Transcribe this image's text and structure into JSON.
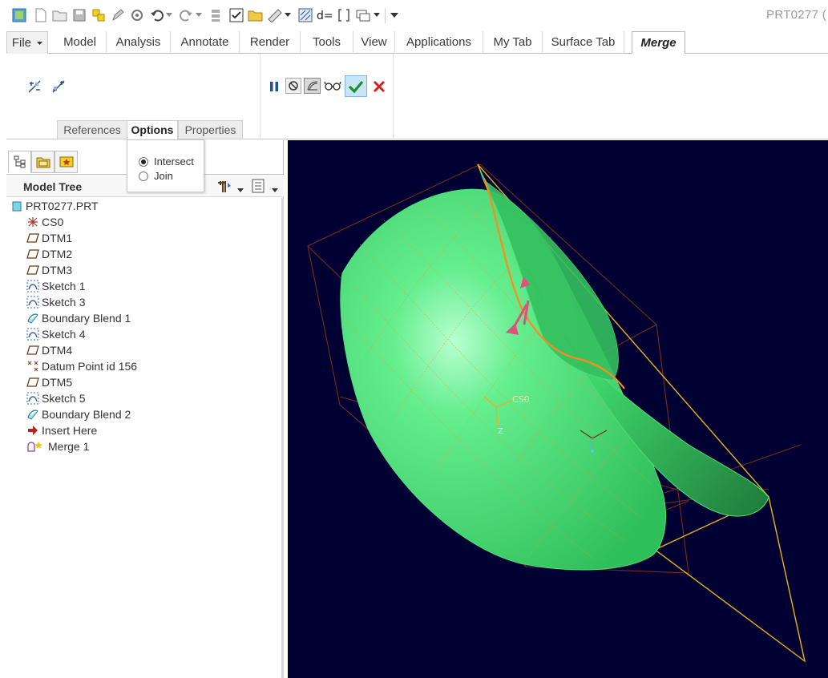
{
  "window": {
    "title": "PRT0277 ("
  },
  "quick_access": {
    "icons": [
      "model-icon",
      "new-icon",
      "open-icon",
      "save-icon",
      "regenerate-icon",
      "edit-icon",
      "settings-icon",
      "undo-icon",
      "redo-icon",
      "repeat-icon",
      "checkmark-box-icon",
      "folder-icon",
      "ruler-icon",
      "datum-display-icon",
      "dimension-icon",
      "brackets-icon",
      "window-icon",
      "customize-icon"
    ]
  },
  "ribbon": {
    "tabs": [
      {
        "label": "File"
      },
      {
        "label": "Model"
      },
      {
        "label": "Analysis"
      },
      {
        "label": "Annotate"
      },
      {
        "label": "Render"
      },
      {
        "label": "Tools"
      },
      {
        "label": "View"
      },
      {
        "label": "Applications"
      },
      {
        "label": "My Tab"
      },
      {
        "label": "Surface Tab"
      },
      {
        "label": "Merge"
      }
    ],
    "active_tab": "Merge"
  },
  "dashboard": {
    "subtabs": [
      {
        "label": "References"
      },
      {
        "label": "Options"
      },
      {
        "label": "Properties"
      }
    ],
    "active_subtab": "Options",
    "options": {
      "choices": [
        {
          "label": "Intersect",
          "selected": true
        },
        {
          "label": "Join",
          "selected": false
        }
      ]
    },
    "accent_ok": "#1a8f2e",
    "accent_cancel": "#d42020"
  },
  "navigator": {
    "title": "Model Tree",
    "items": [
      {
        "label": "PRT0277.PRT",
        "icon": "part-icon"
      },
      {
        "label": "CS0",
        "icon": "coordinate-system-icon"
      },
      {
        "label": "DTM1",
        "icon": "datum-plane-icon"
      },
      {
        "label": "DTM2",
        "icon": "datum-plane-icon"
      },
      {
        "label": "DTM3",
        "icon": "datum-plane-icon"
      },
      {
        "label": "Sketch 1",
        "icon": "sketch-icon"
      },
      {
        "label": "Sketch 3",
        "icon": "sketch-icon"
      },
      {
        "label": "Boundary Blend 1",
        "icon": "boundary-blend-icon"
      },
      {
        "label": "Sketch 4",
        "icon": "sketch-icon"
      },
      {
        "label": "DTM4",
        "icon": "datum-plane-icon"
      },
      {
        "label": "Datum Point id 156",
        "icon": "datum-point-icon"
      },
      {
        "label": "DTM5",
        "icon": "datum-plane-icon"
      },
      {
        "label": "Sketch 5",
        "icon": "sketch-icon"
      },
      {
        "label": "Boundary Blend 2",
        "icon": "boundary-blend-icon"
      },
      {
        "label": "Insert Here",
        "icon": "insert-arrow-icon"
      },
      {
        "label": "Merge 1",
        "icon": "merge-icon"
      }
    ]
  },
  "graphics": {
    "background": "#000132",
    "surface_color": "#3ddc6a",
    "csys_label": "CS0",
    "axis_label": "Z"
  }
}
